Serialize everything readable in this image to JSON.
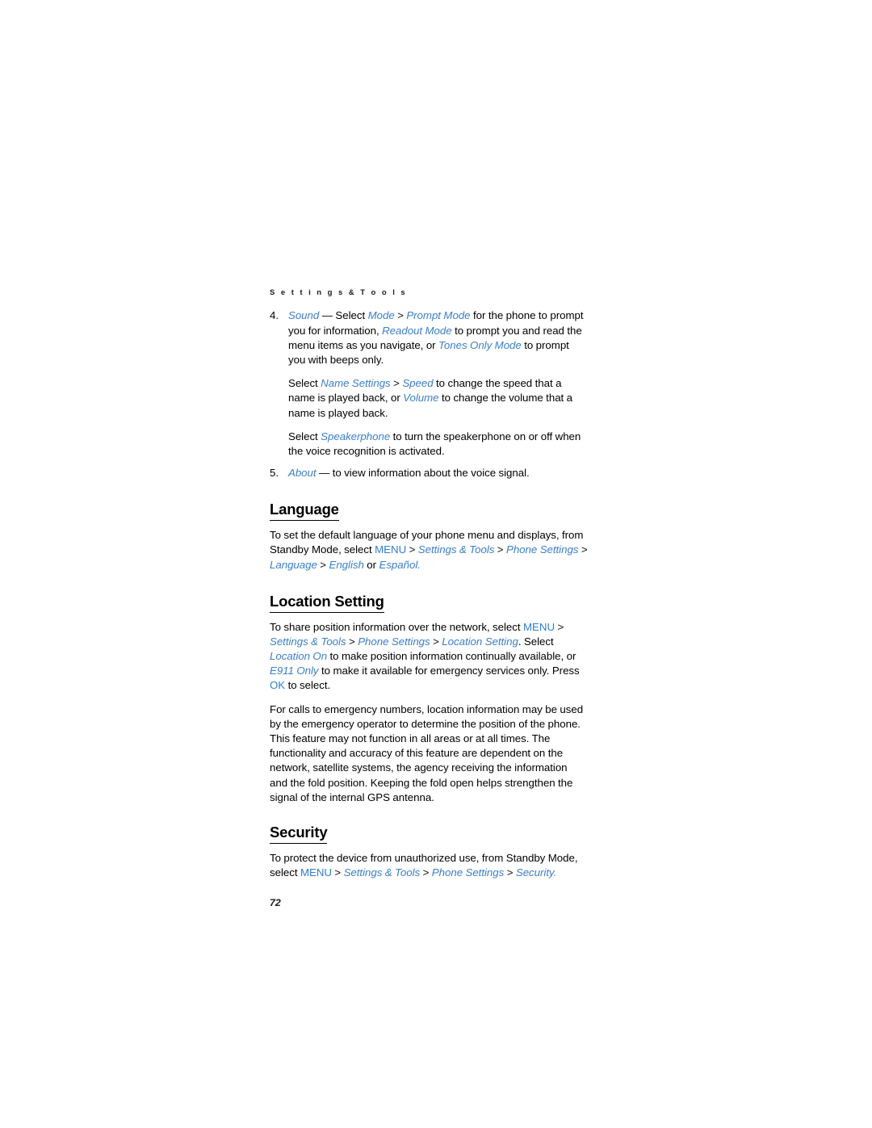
{
  "document": {
    "running_header": "S e t t i n g s   &   T o o l s",
    "page_number": "72",
    "accent_blue": "#3b7ec9",
    "key_blue": "#2f7fd0",
    "text_color": "#000000"
  },
  "list": {
    "item4": {
      "number": "4.",
      "seg1_term": "Sound",
      "seg2": " — Select ",
      "seg3_term": "Mode",
      "seg4": " > ",
      "seg5_term": "Prompt Mode",
      "seg6": " for the phone to prompt you for information, ",
      "seg7_term": "Readout Mode",
      "seg8": " to prompt you and read the menu items as you navigate, or ",
      "seg9_term": "Tones Only Mode",
      "seg10": " to prompt you with beeps only.",
      "para2_a": "Select ",
      "para2_term1": "Name Settings",
      "para2_b": " > ",
      "para2_term2": "Speed",
      "para2_c": " to change the speed that a name is played back, or ",
      "para2_term3": "Volume",
      "para2_d": " to change the volume that a name is played back.",
      "para3_a": "Select ",
      "para3_term1": "Speakerphone",
      "para3_b": " to turn the speakerphone on or off when the voice recognition is activated."
    },
    "item5": {
      "number": "5.",
      "term": "About",
      "text": " — to view information about the voice signal."
    }
  },
  "sections": [
    {
      "heading": "Language",
      "paragraph": {
        "a": "To set the default language of your phone menu and displays, from Standby Mode, select ",
        "key1": "MENU",
        "b": " > ",
        "term1": "Settings & Tools",
        "c": " > ",
        "term2": "Phone Settings",
        "d": " > ",
        "term3": "Language",
        "e": " > ",
        "term4": "English",
        "f": " or ",
        "term5": "Español",
        "g": "."
      }
    },
    {
      "heading": "Location Setting",
      "paragraph1": {
        "a": "To share position information over the network, select ",
        "key1": "MENU",
        "b": " > ",
        "term1": "Settings & Tools",
        "c": " > ",
        "term2": "Phone Settings",
        "d": " > ",
        "term3": "Location Setting",
        "e": ". Select ",
        "term4": "Location On",
        "f": " to make position information continually available, or ",
        "term5": "E911 Only",
        "g": " to make it available for emergency services only. Press ",
        "key2": "OK",
        "h": " to select."
      },
      "paragraph2": "For calls to emergency numbers, location information may be used by the emergency operator to determine the position of the phone. This feature may not function in all areas or at all times. The functionality and accuracy of this feature are dependent on the network, satellite systems, the agency receiving the information and the fold position. Keeping the fold open helps strengthen the signal of the internal GPS antenna."
    },
    {
      "heading": "Security",
      "paragraph": {
        "a": "To protect the device from unauthorized use, from Standby Mode, select ",
        "key1": "MENU",
        "b": " > ",
        "term1": "Settings & Tools",
        "c": "  > ",
        "term2": "Phone Settings",
        "d": " > ",
        "term3": "Security",
        "e": "."
      }
    }
  ]
}
